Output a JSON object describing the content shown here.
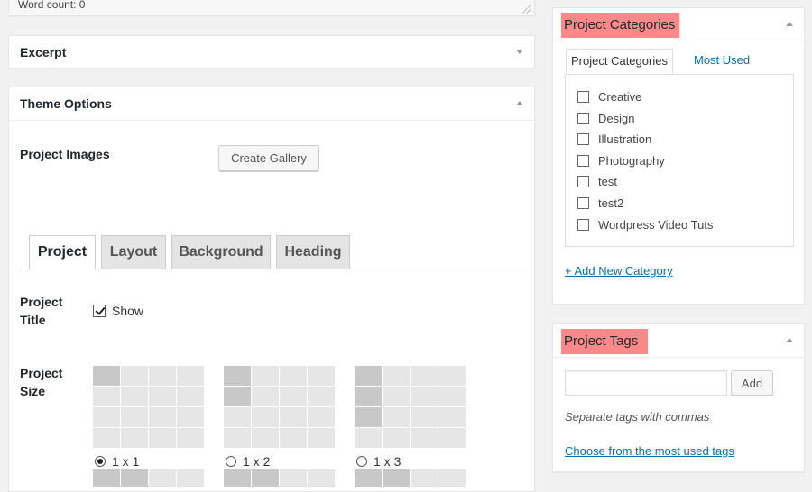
{
  "editor": {
    "word_count": "Word count: 0"
  },
  "excerpt": {
    "title": "Excerpt"
  },
  "theme_options": {
    "title": "Theme Options",
    "project_images_label": "Project Images",
    "create_gallery_label": "Create Gallery",
    "tabs": [
      {
        "label": "Project",
        "active": true
      },
      {
        "label": "Layout",
        "active": false
      },
      {
        "label": "Background",
        "active": false
      },
      {
        "label": "Heading",
        "active": false
      }
    ],
    "project_title": {
      "label_line1": "Project",
      "label_line2": "Title",
      "show_label": "Show",
      "checked": true
    },
    "project_size": {
      "label_line1": "Project",
      "label_line2": "Size",
      "options": [
        {
          "label": "1 x 1",
          "selected": true
        },
        {
          "label": "1 x 2",
          "selected": false
        },
        {
          "label": "1 x 3",
          "selected": false
        }
      ]
    }
  },
  "categories": {
    "title": "Project Categories",
    "tab_all": "Project Categories",
    "tab_most_used": "Most Used",
    "items": [
      {
        "label": "Creative",
        "checked": false
      },
      {
        "label": "Design",
        "checked": false
      },
      {
        "label": "Illustration",
        "checked": false
      },
      {
        "label": "Photography",
        "checked": false
      },
      {
        "label": "test",
        "checked": false
      },
      {
        "label": "test2",
        "checked": false
      },
      {
        "label": "Wordpress Video Tuts",
        "checked": false
      }
    ],
    "add_new": "+ Add New Category"
  },
  "tags": {
    "title": "Project Tags",
    "add_label": "Add",
    "input_value": "",
    "hint": "Separate tags with commas",
    "choose_link": "Choose from the most used tags"
  },
  "colors": {
    "highlight": "#fa8a8a",
    "link": "#0073aa",
    "background": "#f1f1f1"
  }
}
